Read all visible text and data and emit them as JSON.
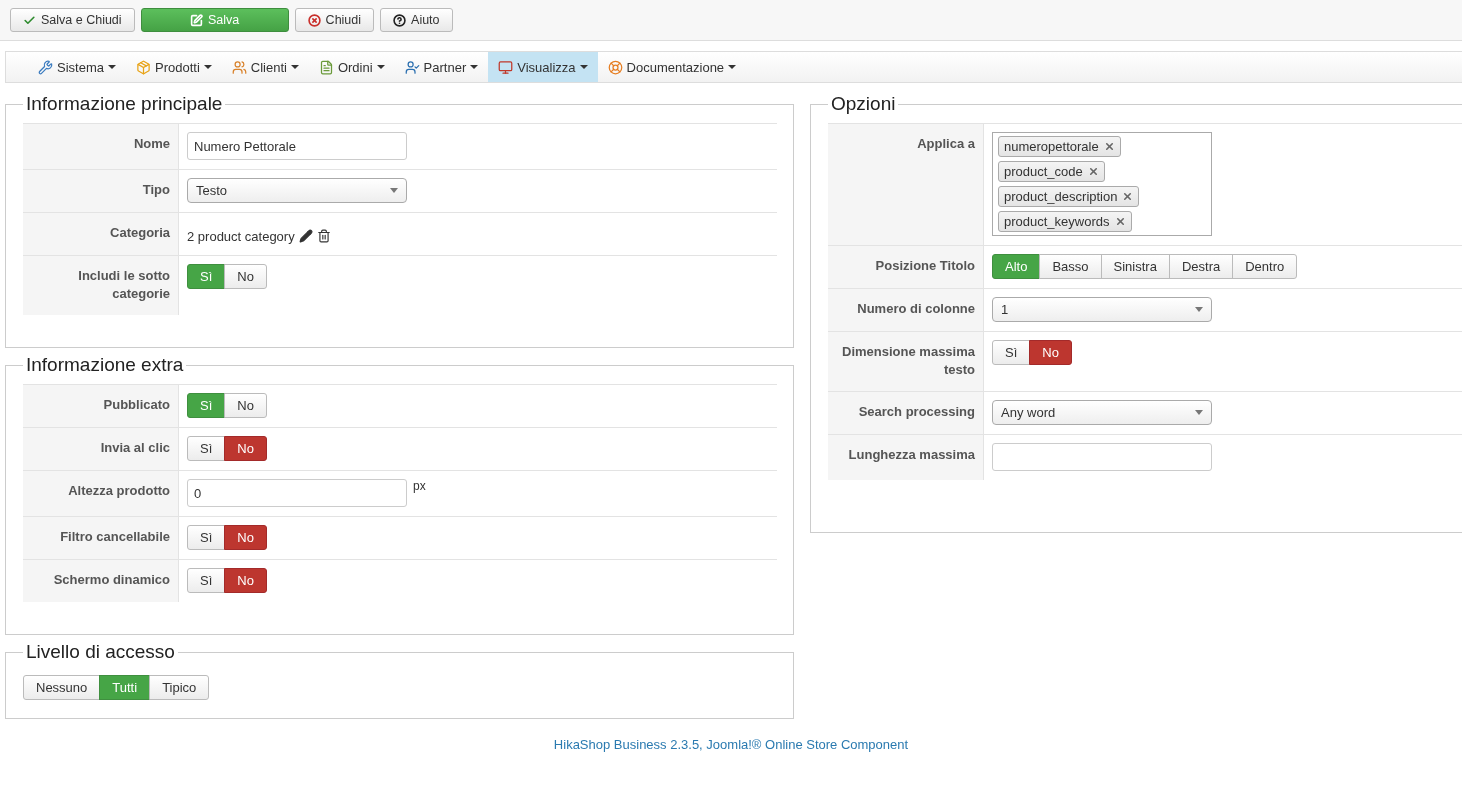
{
  "toolbar": [
    {
      "label": "Salva e Chiudi",
      "kind": "check"
    },
    {
      "label": "Salva",
      "kind": "save"
    },
    {
      "label": "Chiudi",
      "kind": "close"
    },
    {
      "label": "Aiuto",
      "kind": "help"
    }
  ],
  "menu": [
    {
      "label": "Sistema",
      "kind": "tools",
      "selected": false
    },
    {
      "label": "Prodotti",
      "kind": "box",
      "selected": false
    },
    {
      "label": "Clienti",
      "kind": "users",
      "selected": false
    },
    {
      "label": "Ordini",
      "kind": "orders",
      "selected": false
    },
    {
      "label": "Partner",
      "kind": "partner",
      "selected": false
    },
    {
      "label": "Visualizza",
      "kind": "display",
      "selected": true
    },
    {
      "label": "Documentazione",
      "kind": "help",
      "selected": false
    }
  ],
  "left_sections": [
    {
      "title": "Informazione principale",
      "rows": [
        {
          "label": "Nome",
          "kind": "text",
          "value": "Numero Pettorale"
        },
        {
          "label": "Tipo",
          "kind": "select",
          "value": "Testo"
        },
        {
          "label": "Categoria",
          "kind": "category",
          "value": "2 product category"
        },
        {
          "label": "Includi le sotto categorie",
          "kind": "toggle",
          "options": [
            {
              "label": "Sì",
              "selected": true
            },
            {
              "label": "No",
              "selected": false
            }
          ]
        }
      ]
    },
    {
      "title": "Informazione extra",
      "rows": [
        {
          "label": "Pubblicato",
          "kind": "toggle",
          "options": [
            {
              "label": "Sì",
              "selected": true
            },
            {
              "label": "No",
              "selected": false
            }
          ]
        },
        {
          "label": "Invia al clic",
          "kind": "toggle",
          "options": [
            {
              "label": "Sì",
              "selected": false
            },
            {
              "label": "No",
              "kind": "negative",
              "selected": true
            }
          ]
        },
        {
          "label": "Altezza prodotto",
          "kind": "unit",
          "value": "0",
          "unit": "px"
        },
        {
          "label": "Filtro cancellabile",
          "kind": "toggle",
          "options": [
            {
              "label": "Sì",
              "selected": false
            },
            {
              "label": "No",
              "kind": "negative",
              "selected": true
            }
          ]
        },
        {
          "label": "Schermo dinamico",
          "kind": "toggle",
          "options": [
            {
              "label": "Sì",
              "selected": false
            },
            {
              "label": "No",
              "kind": "negative",
              "selected": true
            }
          ]
        }
      ]
    }
  ],
  "access": {
    "title": "Livello di accesso",
    "options": [
      {
        "label": "Nessuno",
        "selected": false
      },
      {
        "label": "Tutti",
        "selected": true
      },
      {
        "label": "Tipico",
        "selected": false
      }
    ]
  },
  "options_section": {
    "title": "Opzioni",
    "rows": [
      {
        "label": "Applica a",
        "kind": "tags",
        "tags": [
          "numeropettorale",
          "product_code",
          "product_description",
          "product_keywords"
        ]
      },
      {
        "label": "Posizione Titolo",
        "kind": "toggle",
        "options": [
          {
            "label": "Alto",
            "selected": true
          },
          {
            "label": "Basso",
            "selected": false
          },
          {
            "label": "Sinistra",
            "selected": false
          },
          {
            "label": "Destra",
            "selected": false
          },
          {
            "label": "Dentro",
            "selected": false
          }
        ]
      },
      {
        "label": "Numero di colonne",
        "kind": "select",
        "value": "1"
      },
      {
        "label": "Dimensione massima testo",
        "kind": "toggle",
        "options": [
          {
            "label": "Sì",
            "selected": false
          },
          {
            "label": "No",
            "kind": "negative",
            "selected": true
          }
        ]
      },
      {
        "label": "Search processing",
        "kind": "select",
        "value": "Any word"
      },
      {
        "label": "Lunghezza massima",
        "kind": "text",
        "value": ""
      }
    ]
  },
  "footer": "HikaShop Business 2.3.5, Joomla!® Online Store Component"
}
